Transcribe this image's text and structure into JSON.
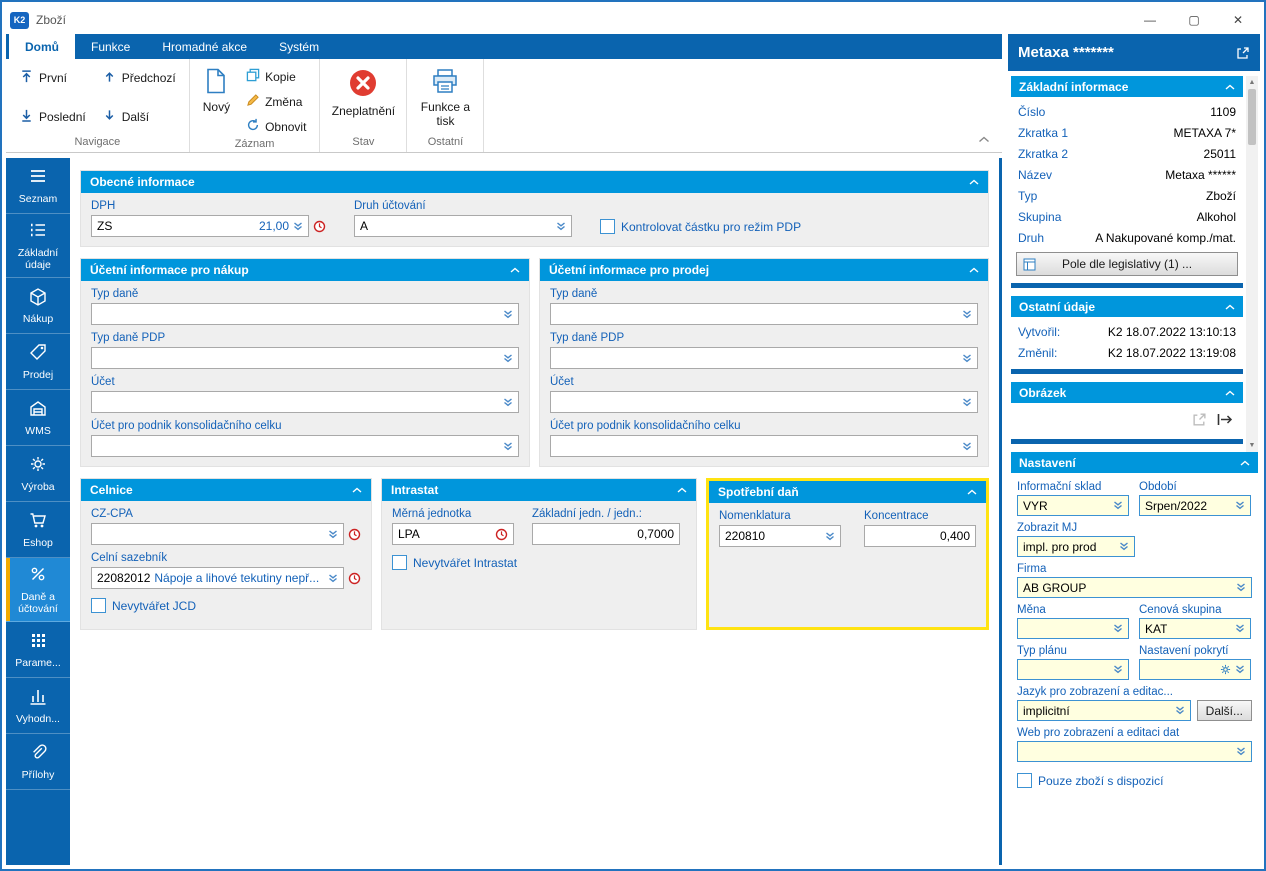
{
  "colors": {
    "dark_blue": "#0A64AE",
    "section_blue": "#0096DC",
    "label_blue": "#1361B8",
    "highlight_yellow": "#FFE312",
    "field_yellow": "#FFFFE0",
    "invalid_red": "#E03C31",
    "active_item_orange": "#F2A900"
  },
  "icons": {
    "dropdown": "double-chevron-down",
    "history_clock": "red-clock",
    "collapse": "chevron-up",
    "popout": "arrow-out-of-box",
    "gear": "gear",
    "invalidate": "red-circle-x",
    "print": "printer",
    "pencil": "edit",
    "copy": "two-pages",
    "refresh": "circular-arrow"
  },
  "window": {
    "title": "Zboží",
    "app_badge": "K2",
    "controls": {
      "minimize": "—",
      "maximize": "▢",
      "close": "✕"
    }
  },
  "ribbon": {
    "tabs": [
      {
        "label": "Domů"
      },
      {
        "label": "Funkce"
      },
      {
        "label": "Hromadné akce"
      },
      {
        "label": "Systém"
      }
    ],
    "groups": [
      {
        "label": "Navigace",
        "buttons": [
          {
            "label": "První"
          },
          {
            "label": "Poslední"
          },
          {
            "label": "Předchozí"
          },
          {
            "label": "Další"
          }
        ]
      },
      {
        "label": "Záznam",
        "buttons": [
          {
            "label": "Nový"
          },
          {
            "label": "Kopie"
          },
          {
            "label": "Změna"
          },
          {
            "label": "Obnovit"
          }
        ]
      },
      {
        "label": "Stav",
        "buttons": [
          {
            "label": "Zneplatnění"
          }
        ]
      },
      {
        "label": "Ostatní",
        "buttons": [
          {
            "label": "Funkce a tisk"
          }
        ]
      }
    ]
  },
  "sidebar": {
    "items": [
      {
        "label": "Seznam"
      },
      {
        "label": "Základní údaje"
      },
      {
        "label": "Nákup"
      },
      {
        "label": "Prodej"
      },
      {
        "label": "WMS"
      },
      {
        "label": "Výroba"
      },
      {
        "label": "Eshop"
      },
      {
        "label": "Daně a účtování",
        "active": true
      },
      {
        "label": "Parame..."
      },
      {
        "label": "Vyhodn..."
      },
      {
        "label": "Přílohy"
      }
    ]
  },
  "main": {
    "obecne": {
      "title": "Obecné informace",
      "dph": {
        "label": "DPH",
        "value": "ZS",
        "rate": "21,00"
      },
      "druh_uctovani": {
        "label": "Druh účtování",
        "value": "A"
      },
      "pdp_checkbox_label": "Kontrolovat částku pro režim PDP"
    },
    "nakup": {
      "title": "Účetní informace pro nákup",
      "fields": [
        {
          "label": "Typ daně",
          "value": ""
        },
        {
          "label": "Typ daně PDP",
          "value": ""
        },
        {
          "label": "Účet",
          "value": ""
        },
        {
          "label": "Účet pro podnik konsolidačního celku",
          "value": ""
        }
      ]
    },
    "prodej": {
      "title": "Účetní informace pro prodej",
      "fields": [
        {
          "label": "Typ daně",
          "value": ""
        },
        {
          "label": "Typ daně PDP",
          "value": ""
        },
        {
          "label": "Účet",
          "value": ""
        },
        {
          "label": "Účet pro podnik konsolidačního celku",
          "value": ""
        }
      ]
    },
    "celnice": {
      "title": "Celnice",
      "cz_cpa": {
        "label": "CZ-CPA",
        "value": ""
      },
      "celni_sazebnik": {
        "label": "Celní sazebník",
        "code": "22082012",
        "description": "Nápoje a lihové tekutiny nepř..."
      },
      "jcd_checkbox_label": "Nevytvářet JCD"
    },
    "intrastat": {
      "title": "Intrastat",
      "merna_jednotka": {
        "label": "Měrná jednotka",
        "value": "LPA"
      },
      "zakladni_jedn": {
        "label": "Základní jedn. / jedn.:",
        "value": "0,7000"
      },
      "intrastat_checkbox_label": "Nevytvářet Intrastat"
    },
    "spotrebni_dan": {
      "title": "Spotřební daň",
      "nomenklatura": {
        "label": "Nomenklatura",
        "value": "220810"
      },
      "koncentrace": {
        "label": "Koncentrace",
        "value": "0,400"
      }
    }
  },
  "right_panel": {
    "title": "Metaxa *******",
    "scroll": {
      "up": "▲",
      "down": "▼"
    },
    "zakladni_informace": {
      "title": "Základní informace",
      "rows": [
        {
          "label": "Číslo",
          "value": "1109"
        },
        {
          "label": "Zkratka 1",
          "value": "METAXA 7*"
        },
        {
          "label": "Zkratka 2",
          "value": "25011"
        },
        {
          "label": "Název",
          "value": "Metaxa ******"
        },
        {
          "label": "Typ",
          "value": "Zboží"
        },
        {
          "label": "Skupina",
          "value": "Alkohol"
        },
        {
          "label": "Druh",
          "value": "A Nakupované komp./mat."
        }
      ],
      "legislativa_button": "Pole dle legislativy (1) ..."
    },
    "ostatni_udaje": {
      "title": "Ostatní údaje",
      "rows": [
        {
          "label": "Vytvořil:",
          "value": "K2 18.07.2022 13:10:13"
        },
        {
          "label": "Změnil:",
          "value": "K2 18.07.2022 13:19:08"
        }
      ]
    },
    "obrazek": {
      "title": "Obrázek"
    },
    "nastaveni": {
      "title": "Nastavení",
      "informacni_sklad": {
        "label": "Informační sklad",
        "value": "VYR"
      },
      "obdobi": {
        "label": "Období",
        "value": "Srpen/2022"
      },
      "zobrazit_mj": {
        "label": "Zobrazit MJ",
        "value": "impl. pro prod"
      },
      "firma": {
        "label": "Firma",
        "value": "AB GROUP"
      },
      "mena": {
        "label": "Měna",
        "value": ""
      },
      "cenova_skupina": {
        "label": "Cenová skupina",
        "value": "KAT"
      },
      "typ_planu": {
        "label": "Typ plánu",
        "value": ""
      },
      "nastaveni_pokryti": {
        "label": "Nastavení pokrytí"
      },
      "jazyk": {
        "label": "Jazyk pro zobrazení a editac...",
        "value": "implicitní"
      },
      "dalsi_button": "Další...",
      "web": {
        "label": "Web pro zobrazení a editaci dat",
        "value": ""
      },
      "dispozice_checkbox_label": "Pouze zboží s dispozicí"
    }
  }
}
